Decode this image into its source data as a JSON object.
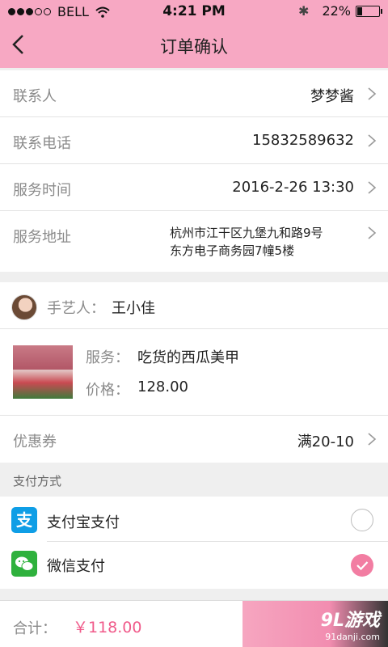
{
  "status_bar": {
    "carrier": "BELL",
    "time": "4:21 PM",
    "battery": "22%",
    "battery_level": 0.22
  },
  "header": {
    "title": "订单确认"
  },
  "contact": {
    "contact_label": "联系人",
    "contact_value": "梦梦酱",
    "phone_label": "联系电话",
    "phone_value": "15832589632",
    "time_label": "服务时间",
    "time_value": "2016-2-26 13:30",
    "address_label": "服务地址",
    "address_line1": "杭州市江干区九堡九和路9号",
    "address_line2": "东方电子商务园7幢5楼"
  },
  "artisan": {
    "label": "手艺人：",
    "name": "王小佳"
  },
  "service": {
    "service_label": "服务：",
    "service_name": "吃货的西瓜美甲",
    "price_label": "价格：",
    "price_value": "128.00"
  },
  "coupon": {
    "label": "优惠券",
    "value": "满20-10"
  },
  "payment": {
    "section_label": "支付方式",
    "alipay_icon_text": "支",
    "alipay_label": "支付宝支付",
    "alipay_selected": false,
    "wechat_label": "微信支付",
    "wechat_selected": true
  },
  "footer": {
    "total_label": "合计：",
    "total_value": "￥118.00",
    "watermark_main": "9L游戏",
    "watermark_sub": "91danji.com"
  },
  "colors": {
    "header_bg": "#f7a8c3",
    "accent_pink": "#f05a8a",
    "alipay_blue": "#0f9ee6",
    "wechat_green": "#2fb13d"
  }
}
